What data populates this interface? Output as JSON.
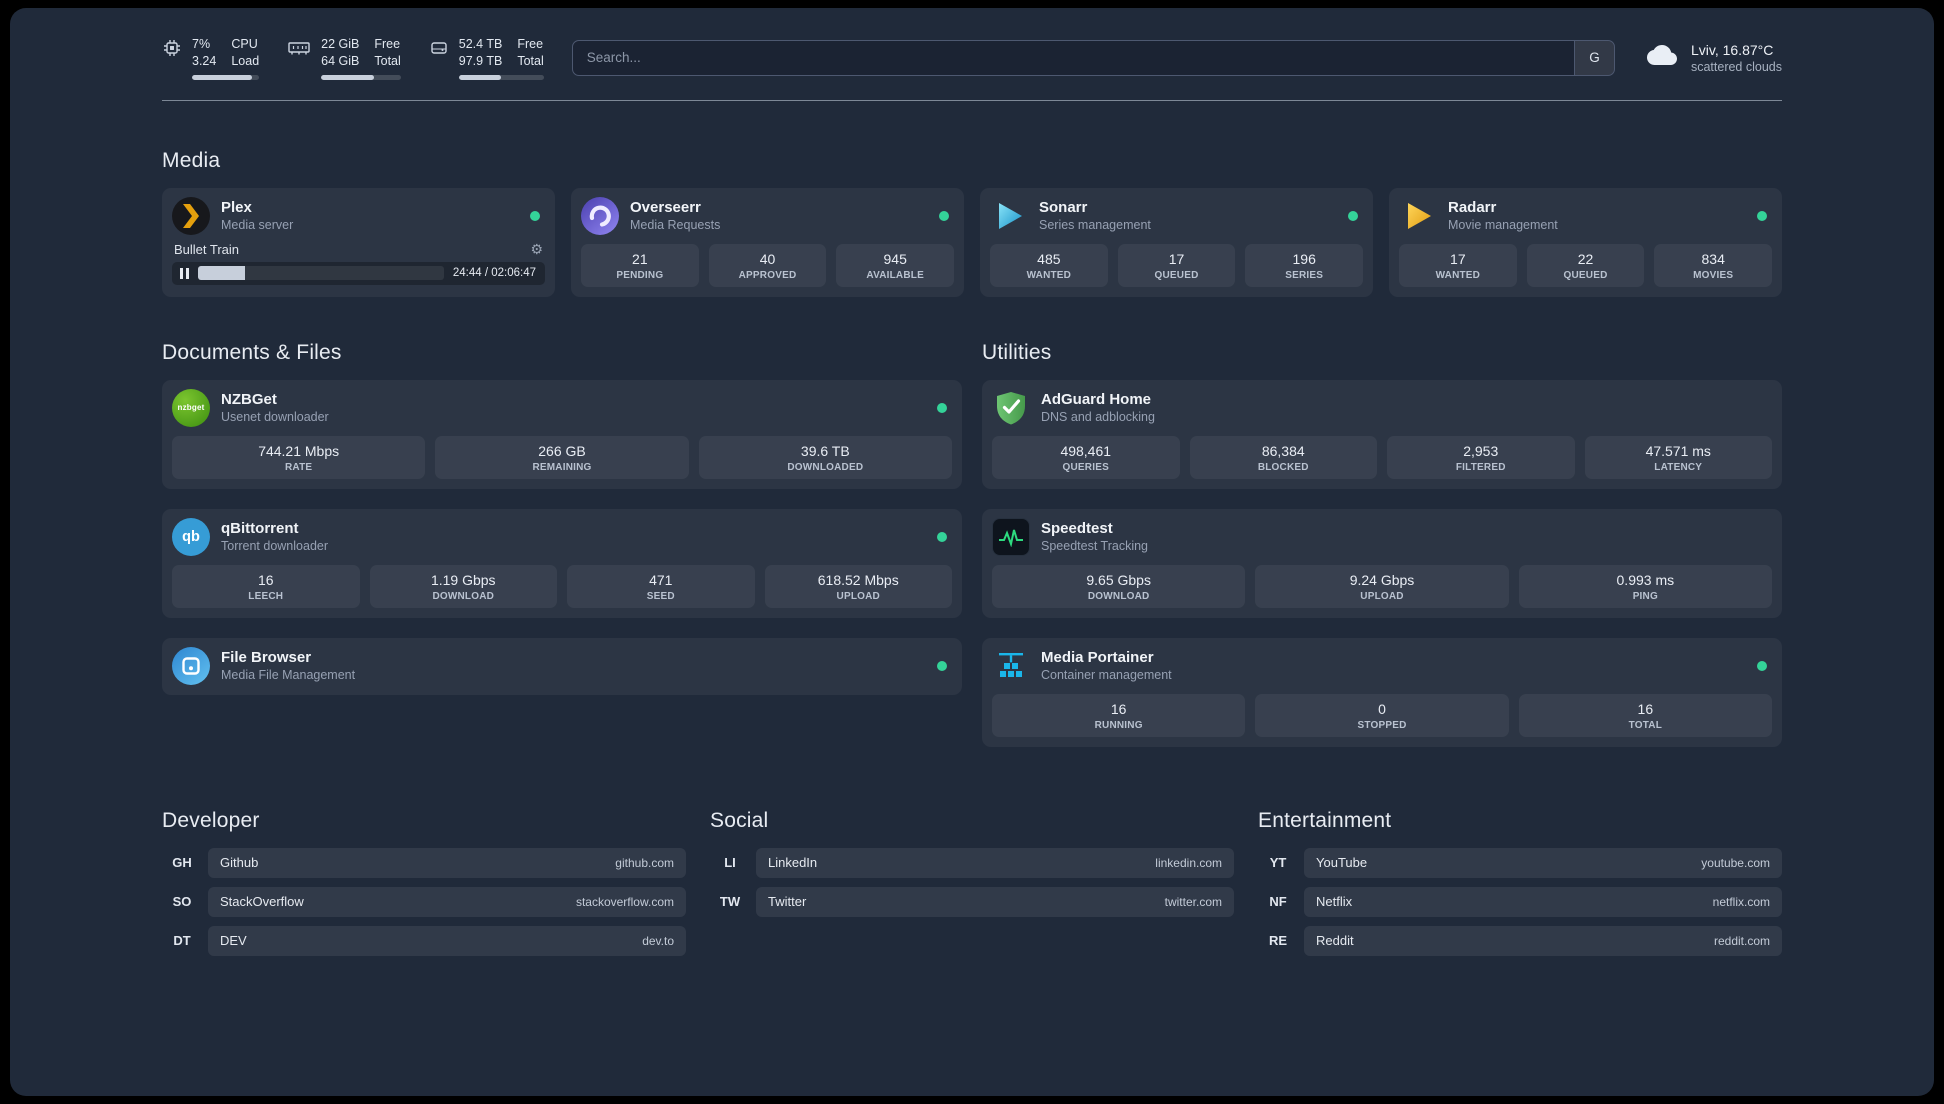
{
  "topbar": {
    "cpu": {
      "value_top": "7%",
      "value_bottom": "3.24",
      "label_top": "CPU",
      "label_bottom": "Load",
      "progress": 90
    },
    "memory": {
      "value_top": "22 GiB",
      "value_bottom": "64 GiB",
      "label_top": "Free",
      "label_bottom": "Total",
      "progress": 66
    },
    "disk": {
      "value_top": "52.4 TB",
      "value_bottom": "97.9 TB",
      "label_top": "Free",
      "label_bottom": "Total",
      "progress": 50
    },
    "search": {
      "placeholder": "Search...",
      "button_label": "G"
    },
    "weather": {
      "location": "Lviv, 16.87°C",
      "condition": "scattered clouds"
    }
  },
  "sections": {
    "media": {
      "title": "Media",
      "cards": [
        {
          "name": "Plex",
          "desc": "Media server",
          "icon": "plex-icon",
          "online": true,
          "player": {
            "title": "Bullet Train",
            "time": "24:44 / 02:06:47",
            "progress": 19,
            "gear": "⚙"
          }
        },
        {
          "name": "Overseerr",
          "desc": "Media Requests",
          "icon": "overseerr-icon",
          "online": true,
          "stats": [
            {
              "value": "21",
              "label": "PENDING"
            },
            {
              "value": "40",
              "label": "APPROVED"
            },
            {
              "value": "945",
              "label": "AVAILABLE"
            }
          ]
        },
        {
          "name": "Sonarr",
          "desc": "Series management",
          "icon": "sonarr-icon",
          "online": true,
          "stats": [
            {
              "value": "485",
              "label": "WANTED"
            },
            {
              "value": "17",
              "label": "QUEUED"
            },
            {
              "value": "196",
              "label": "SERIES"
            }
          ]
        },
        {
          "name": "Radarr",
          "desc": "Movie management",
          "icon": "radarr-icon",
          "online": true,
          "stats": [
            {
              "value": "17",
              "label": "WANTED"
            },
            {
              "value": "22",
              "label": "QUEUED"
            },
            {
              "value": "834",
              "label": "MOVIES"
            }
          ]
        }
      ]
    },
    "documents": {
      "title": "Documents & Files",
      "cards": [
        {
          "name": "NZBGet",
          "desc": "Usenet downloader",
          "icon": "nzbget-icon",
          "online": true,
          "stats": [
            {
              "value": "744.21 Mbps",
              "label": "RATE"
            },
            {
              "value": "266 GB",
              "label": "REMAINING"
            },
            {
              "value": "39.6 TB",
              "label": "DOWNLOADED"
            }
          ]
        },
        {
          "name": "qBittorrent",
          "desc": "Torrent downloader",
          "icon": "qbittorrent-icon",
          "online": true,
          "stats": [
            {
              "value": "16",
              "label": "LEECH"
            },
            {
              "value": "1.19 Gbps",
              "label": "DOWNLOAD"
            },
            {
              "value": "471",
              "label": "SEED"
            },
            {
              "value": "618.52 Mbps",
              "label": "UPLOAD"
            }
          ]
        },
        {
          "name": "File Browser",
          "desc": "Media File Management",
          "icon": "filebrowser-icon",
          "online": true
        }
      ]
    },
    "utilities": {
      "title": "Utilities",
      "cards": [
        {
          "name": "AdGuard Home",
          "desc": "DNS and adblocking",
          "icon": "adguard-icon",
          "stats": [
            {
              "value": "498,461",
              "label": "QUERIES"
            },
            {
              "value": "86,384",
              "label": "BLOCKED"
            },
            {
              "value": "2,953",
              "label": "FILTERED"
            },
            {
              "value": "47.571 ms",
              "label": "LATENCY"
            }
          ]
        },
        {
          "name": "Speedtest",
          "desc": "Speedtest Tracking",
          "icon": "speedtest-icon",
          "stats": [
            {
              "value": "9.65 Gbps",
              "label": "DOWNLOAD"
            },
            {
              "value": "9.24 Gbps",
              "label": "UPLOAD"
            },
            {
              "value": "0.993 ms",
              "label": "PING"
            }
          ]
        },
        {
          "name": "Media Portainer",
          "desc": "Container management",
          "icon": "portainer-icon",
          "online": true,
          "stats": [
            {
              "value": "16",
              "label": "RUNNING"
            },
            {
              "value": "0",
              "label": "STOPPED"
            },
            {
              "value": "16",
              "label": "TOTAL"
            }
          ]
        }
      ]
    }
  },
  "bookmarks": [
    {
      "title": "Developer",
      "items": [
        {
          "abbr": "GH",
          "name": "Github",
          "domain": "github.com"
        },
        {
          "abbr": "SO",
          "name": "StackOverflow",
          "domain": "stackoverflow.com"
        },
        {
          "abbr": "DT",
          "name": "DEV",
          "domain": "dev.to"
        }
      ]
    },
    {
      "title": "Social",
      "items": [
        {
          "abbr": "LI",
          "name": "LinkedIn",
          "domain": "linkedin.com"
        },
        {
          "abbr": "TW",
          "name": "Twitter",
          "domain": "twitter.com"
        }
      ]
    },
    {
      "title": "Entertainment",
      "items": [
        {
          "abbr": "YT",
          "name": "YouTube",
          "domain": "youtube.com"
        },
        {
          "abbr": "NF",
          "name": "Netflix",
          "domain": "netflix.com"
        },
        {
          "abbr": "RE",
          "name": "Reddit",
          "domain": "reddit.com"
        }
      ]
    }
  ]
}
